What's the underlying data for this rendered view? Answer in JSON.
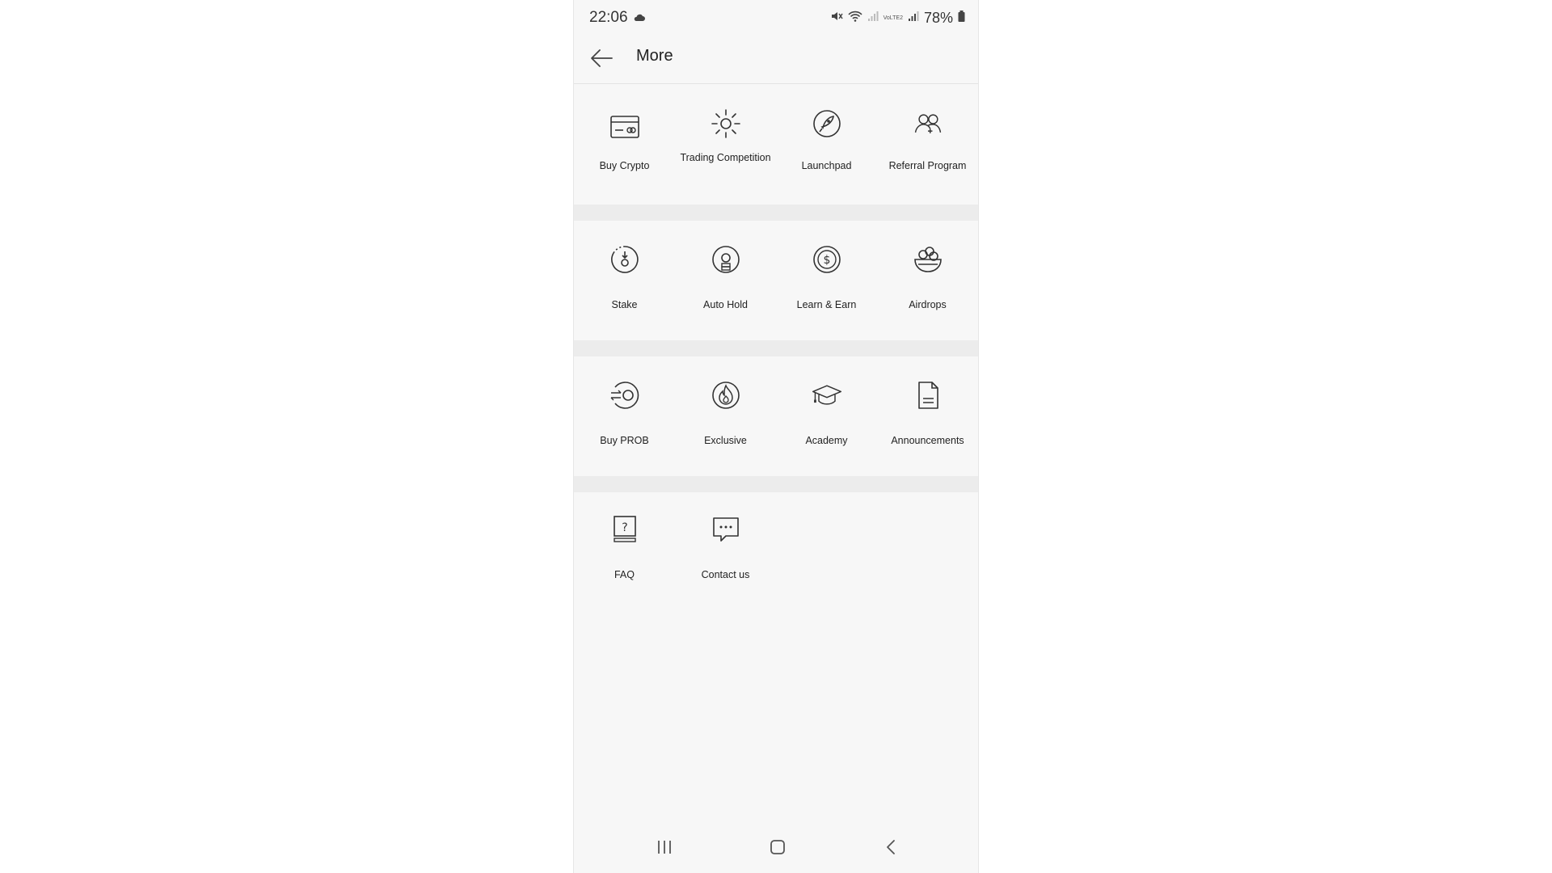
{
  "status_bar": {
    "time": "22:06",
    "network_label": "VoLTE2",
    "battery": "78%"
  },
  "header": {
    "title": "More"
  },
  "sections": [
    {
      "items": [
        {
          "label": "Buy Crypto",
          "icon": "credit-card-icon"
        },
        {
          "label": "Trading Competition",
          "icon": "sun-icon"
        },
        {
          "label": "Launchpad",
          "icon": "rocket-icon"
        },
        {
          "label": "Referral Program",
          "icon": "users-icon"
        }
      ]
    },
    {
      "items": [
        {
          "label": "Stake",
          "icon": "stake-icon"
        },
        {
          "label": "Auto Hold",
          "icon": "auto-hold-icon"
        },
        {
          "label": "Learn & Earn",
          "icon": "dollar-coin-icon"
        },
        {
          "label": "Airdrops",
          "icon": "basket-icon"
        }
      ]
    },
    {
      "items": [
        {
          "label": "Buy PROB",
          "icon": "exchange-coin-icon"
        },
        {
          "label": "Exclusive",
          "icon": "flame-icon"
        },
        {
          "label": "Academy",
          "icon": "graduation-cap-icon"
        },
        {
          "label": "Announcements",
          "icon": "document-icon"
        }
      ]
    },
    {
      "items": [
        {
          "label": "FAQ",
          "icon": "faq-icon"
        },
        {
          "label": "Contact us",
          "icon": "chat-bubble-icon"
        }
      ]
    }
  ],
  "colors": {
    "background": "#f7f7f7",
    "separator": "#ececec",
    "text": "#222222",
    "icon_stroke": "#333333"
  }
}
